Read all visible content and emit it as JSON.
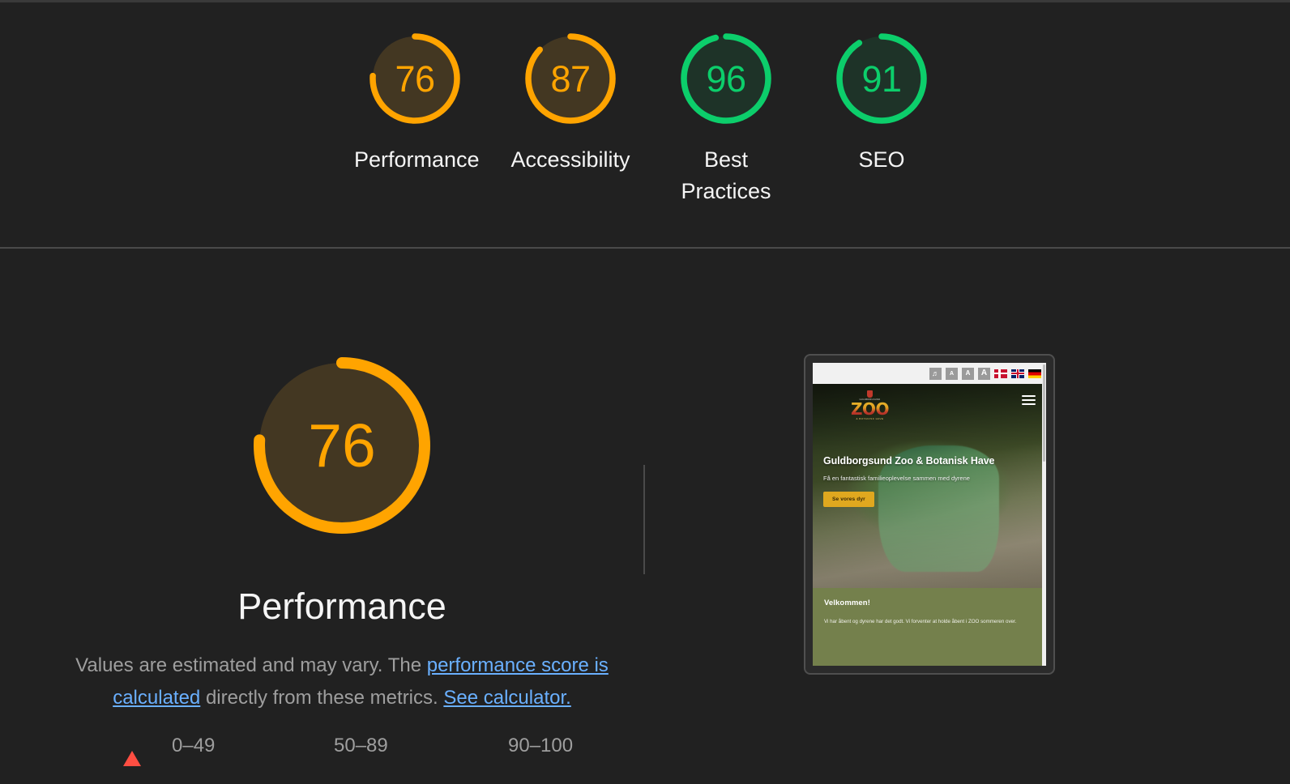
{
  "report": {
    "scores": [
      {
        "value": 76,
        "label": "Performance",
        "color": "#ffa400",
        "track": "#433722",
        "level": "orange"
      },
      {
        "value": 87,
        "label": "Accessibility",
        "color": "#ffa400",
        "track": "#433722",
        "level": "orange"
      },
      {
        "value": 96,
        "label": "Best Practices",
        "color": "#0cce6b",
        "track": "#1e3328",
        "level": "green"
      },
      {
        "value": 91,
        "label": "SEO",
        "color": "#0cce6b",
        "track": "#1e3328",
        "level": "green"
      }
    ],
    "featured": {
      "value": 76,
      "title": "Performance",
      "color": "#ffa400",
      "track": "#433722",
      "desc_part1": "Values are estimated and may vary. The ",
      "desc_link1": "performance score is calculated",
      "desc_part2": " directly from these metrics. ",
      "desc_link2": "See calculator."
    },
    "legend": [
      {
        "shape": "triangle-icon",
        "range": "0–49",
        "color": "#ff4e42"
      },
      {
        "shape": "square-icon",
        "range": "50–89",
        "color": "#ffa400"
      },
      {
        "shape": "circle-icon",
        "range": "90–100",
        "color": "#0cce6b"
      }
    ]
  },
  "thumbnail": {
    "a11y_bar": {
      "listen_icon": "♫",
      "text_size_small": "A",
      "text_size_medium": "A",
      "text_size_large": "A",
      "flags": [
        "flag-dk-icon",
        "flag-gb-icon",
        "flag-de-icon"
      ]
    },
    "site": {
      "logo_crest_label": "GULDBORGSUND",
      "logo_text": "ZOO",
      "logo_tagline": "& BOTANISK HAVE",
      "menu_icon": "hamburger-icon",
      "hero_heading": "Guldborgsund Zoo & Botanisk Have",
      "hero_subtext": "Få en fantastisk familieoplevelse sammen med dyrene",
      "hero_button": "Se vores dyr",
      "welcome_heading": "Velkommen!",
      "welcome_body": "Vi har åbent og dyrene har det godt. Vi forventer at holde åbent i ZOO sommeren over."
    }
  }
}
